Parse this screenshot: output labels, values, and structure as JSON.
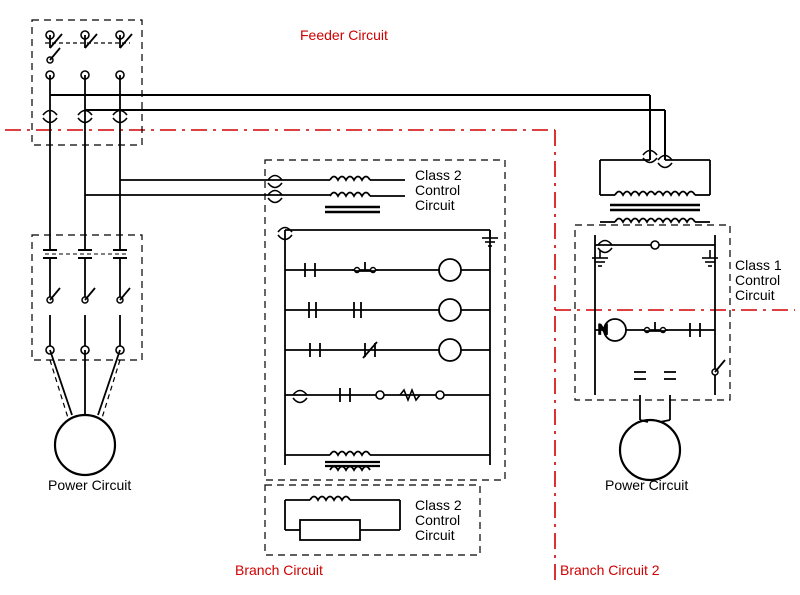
{
  "title": "Feeder Circuit",
  "labels": {
    "feeder": "Feeder Circuit",
    "power_left": "Power Circuit",
    "power_right": "Power Circuit",
    "class2_upper": "Class 2\nControl\nCircuit",
    "class2_lower": "Class 2\nControl\nCircuit",
    "class1": "Class 1\nControl\nCircuit",
    "branch1": "Branch Circuit",
    "branch2": "Branch Circuit 2"
  },
  "colors": {
    "line": "#000000",
    "dash": "#000000",
    "red": "#d00000"
  }
}
